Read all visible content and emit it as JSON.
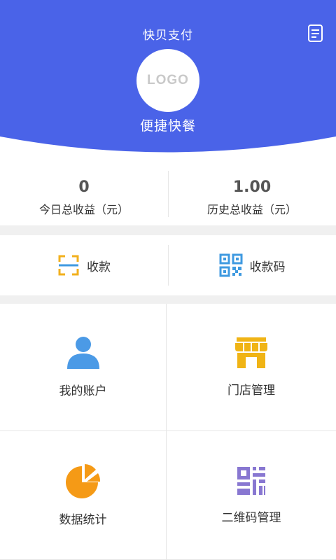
{
  "header": {
    "title": "快贝支付",
    "logo_text": "LOGO",
    "store_name": "便捷快餐",
    "bg_color": "#4a63e8",
    "doc_icon": "document-icon"
  },
  "earnings": [
    {
      "value": "0",
      "label": "今日总收益（元）"
    },
    {
      "value": "1.00",
      "label": "历史总收益（元）"
    }
  ],
  "quick_actions": [
    {
      "label": "收款",
      "icon": "scan-icon",
      "color": "#f2b01e"
    },
    {
      "label": "收款码",
      "icon": "qr-code-icon",
      "color": "#3f9ae0"
    }
  ],
  "menu": [
    {
      "label": "我的账户",
      "icon": "user-icon",
      "color": "#4b9ae6"
    },
    {
      "label": "门店管理",
      "icon": "store-icon",
      "color": "#f0b415"
    },
    {
      "label": "数据统计",
      "icon": "pie-chart-icon",
      "color": "#f59a16"
    },
    {
      "label": "二维码管理",
      "icon": "qr-code-manage-icon",
      "color": "#8877d1"
    }
  ]
}
